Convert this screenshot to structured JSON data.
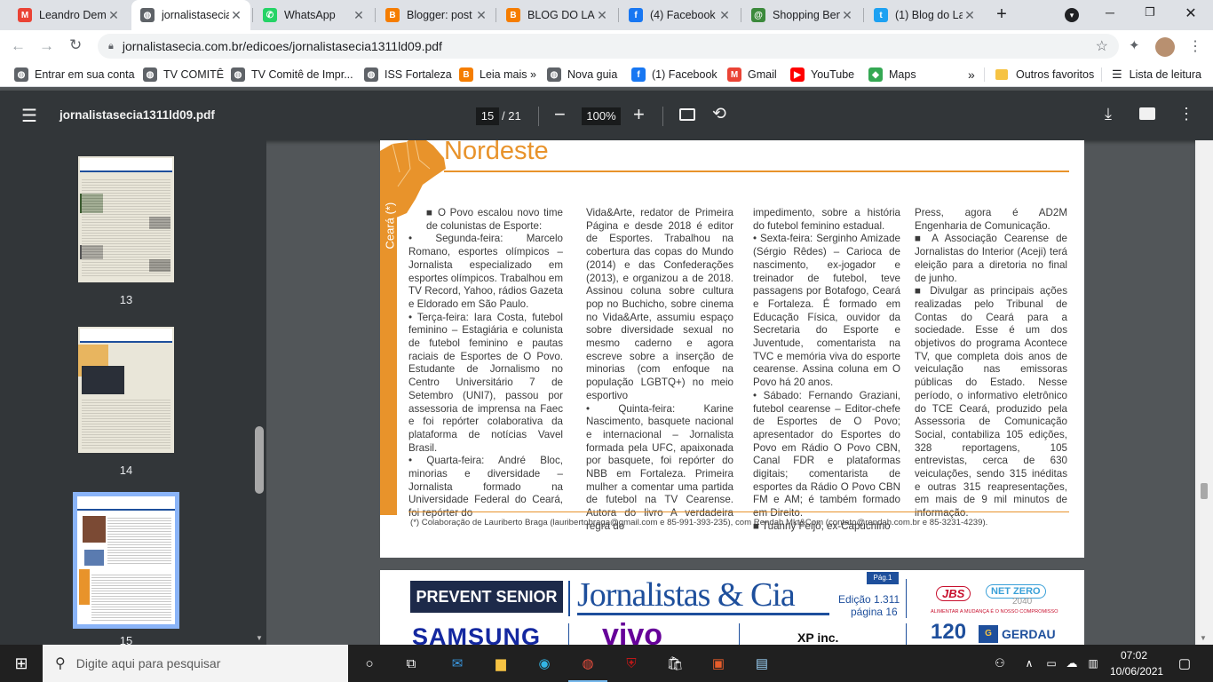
{
  "browser": {
    "tabs": [
      {
        "title": "Leandro Dem",
        "icon": "gmail-icon",
        "color": "#ea4335",
        "letter": "M"
      },
      {
        "title": "jornalistasecia",
        "icon": "globe-icon",
        "color": "#5f6368",
        "letter": "◍"
      },
      {
        "title": "WhatsApp",
        "icon": "whatsapp-icon",
        "color": "#25d366",
        "letter": "✆"
      },
      {
        "title": "Blogger: post",
        "icon": "blogger-icon",
        "color": "#f57d00",
        "letter": "B"
      },
      {
        "title": "BLOG DO LAU",
        "icon": "blogger-icon",
        "color": "#f57d00",
        "letter": "B"
      },
      {
        "title": "(4) Facebook",
        "icon": "facebook-icon",
        "color": "#1877f2",
        "letter": "f"
      },
      {
        "title": "Shopping Ben",
        "icon": "shopping-icon",
        "color": "#3c8a3c",
        "letter": "@"
      },
      {
        "title": "(1) Blog do La",
        "icon": "twitter-icon",
        "color": "#1da1f2",
        "letter": "t"
      }
    ],
    "new_tab": "+",
    "url": "jornalistasecia.com.br/edicoes/jornalistasecia1311ld09.pdf",
    "bookmarks": [
      {
        "label": "Entrar em sua conta",
        "icon": "globe-icon",
        "color": "#5f6368",
        "letter": "◍"
      },
      {
        "label": "TV COMITÊ",
        "icon": "globe-icon",
        "color": "#5f6368",
        "letter": "◍"
      },
      {
        "label": "TV Comitê de Impr...",
        "icon": "globe-icon",
        "color": "#5f6368",
        "letter": "◍"
      },
      {
        "label": "ISS Fortaleza",
        "icon": "globe-icon",
        "color": "#5f6368",
        "letter": "◍"
      },
      {
        "label": "Leia mais »",
        "icon": "blogger-icon",
        "color": "#f57d00",
        "letter": "B"
      },
      {
        "label": "Nova guia",
        "icon": "globe-icon",
        "color": "#5f6368",
        "letter": "◍"
      },
      {
        "label": "(1) Facebook",
        "icon": "facebook-icon",
        "color": "#1877f2",
        "letter": "f"
      },
      {
        "label": "Gmail",
        "icon": "gmail-icon",
        "color": "#ea4335",
        "letter": "M"
      },
      {
        "label": "YouTube",
        "icon": "youtube-icon",
        "color": "#ff0000",
        "letter": "▶"
      },
      {
        "label": "Maps",
        "icon": "maps-icon",
        "color": "#34a853",
        "letter": "◆"
      }
    ],
    "bookmarks_more": "»",
    "other_favorites": "Outros favoritos",
    "reading_list": "Lista de leitura"
  },
  "pdf": {
    "filename": "jornalistasecia1311ld09.pdf",
    "current_page": "15",
    "total_pages": "/ 21",
    "zoom": "100%",
    "thumbs": [
      {
        "num": "13"
      },
      {
        "num": "14"
      },
      {
        "num": "15"
      }
    ],
    "section_title": "Nordeste",
    "section_state": "Ceará (*)",
    "col1": [
      {
        "t": "■ O Povo escalou novo time de colunistas de Esporte:",
        "i": true
      },
      {
        "t": "• Segunda-feira: Marcelo Romano, esportes olímpicos – Jornalista especializado em esportes olímpicos. Trabalhou em TV Record, Yahoo, rádios Gazeta e Eldorado em São Paulo."
      },
      {
        "t": "• Terça-feira: Iara Costa, futebol feminino – Estagiária e colunista de futebol feminino e pautas raciais de Esportes de O Povo. Estudante de Jornalismo no Centro Universitário 7 de Setembro (UNI7), passou por assessoria de imprensa na Faec e foi repórter colaborativa da plataforma de notícias Vavel Brasil."
      },
      {
        "t": "• Quarta-feira: André Bloc, minorias e diversidade – Jornalista formado na Universidade Federal do Ceará, foi repórter do"
      }
    ],
    "col2": [
      {
        "t": "Vida&Arte, redator de Primeira Página e desde 2018 é editor de Esportes. Trabalhou na cobertura das copas do Mundo (2014) e das Confederações (2013), e organizou a de 2018. Assinou coluna sobre cultura pop no Buchicho, sobre cinema no Vida&Arte, assumiu espaço sobre diversidade sexual no mesmo caderno e agora escreve sobre a inserção de minorias (com enfoque na população LGBTQ+) no meio esportivo"
      },
      {
        "t": "• Quinta-feira: Karine Nascimento, basquete nacional e internacional – Jornalista formada pela UFC, apaixonada por basquete, foi repórter do NBB em Fortaleza. Primeira mulher a comentar uma partida de futebol na TV Cearense. Autora do livro A verdadeira regra do"
      }
    ],
    "col3": [
      {
        "t": "impedimento, sobre a história do futebol feminino estadual."
      },
      {
        "t": "• Sexta-feira: Serginho Amizade (Sérgio Rêdes) – Carioca de nascimento, ex-jogador e treinador de futebol, teve passagens por Botafogo, Ceará e Fortaleza. É formado em Educação Física, ouvidor da Secretaria do Esporte e Juventude, comentarista na TVC e memória viva do esporte cearense. Assina coluna em O Povo há 20 anos."
      },
      {
        "t": "• Sábado: Fernando Graziani, futebol cearense – Editor-chefe de Esportes de O Povo; apresentador do Esportes do Povo em Rádio O Povo CBN, Canal FDR e plataformas digitais; comentarista de esportes da Rádio O Povo CBN FM e AM; é também formado em Direito."
      },
      {
        "t": "■ Tuanny Feijó, ex-Capuchino"
      }
    ],
    "col4": [
      {
        "t": "Press, agora é AD2M Engenharia de Comunicação."
      },
      {
        "t": "■ A Associação Cearense de Jornalistas do Interior (Aceji) terá eleição para a diretoria no final de junho."
      },
      {
        "t": "■ Divulgar as principais ações realizadas pelo Tribunal de Contas do Ceará para a sociedade. Esse é um dos objetivos do programa Acontece TV, que completa dois anos de veiculação nas emissoras públicas do Estado. Nesse período, o informativo eletrônico do TCE Ceará, produzido pela Assessoria de Comunicação Social, contabiliza 105 edições, 328 reportagens, 105 entrevistas, cerca de 630 veiculações, sendo 315 inéditas e outras 315 reapresentações, em mais de 9 mil minutos de informação."
      }
    ],
    "footnote": "(*) Colaboração de Lauriberto Braga (lauribertobraga@gmail.com e 85-991-393-235), com Rendah Mkt&Com (contato@rendah.com.br e 85-3231-4239).",
    "next_page": {
      "sponsor1": "PREVENT SENIOR",
      "masthead": "Jornalistas & Cia",
      "edition": "Edição 1.311",
      "page": "página 16",
      "pag_tag": "Pág.1",
      "jbs": "JBS",
      "netzero": "NET ZERO",
      "netzero_year": "2040",
      "netzero_tagline": "ALIMENTAR A MUDANÇA É O NOSSO COMPROMISSO",
      "samsung": "SAMSUNG",
      "vivo": "vivo",
      "xp": "XP inc.",
      "num120": "120",
      "gerdau": "GERDAU"
    }
  },
  "taskbar": {
    "search_placeholder": "Digite aqui para pesquisar",
    "time": "07:02",
    "date": "10/06/2021"
  },
  "colors": {
    "accent_orange": "#e8932b",
    "masthead_blue": "#1e4f9c"
  }
}
